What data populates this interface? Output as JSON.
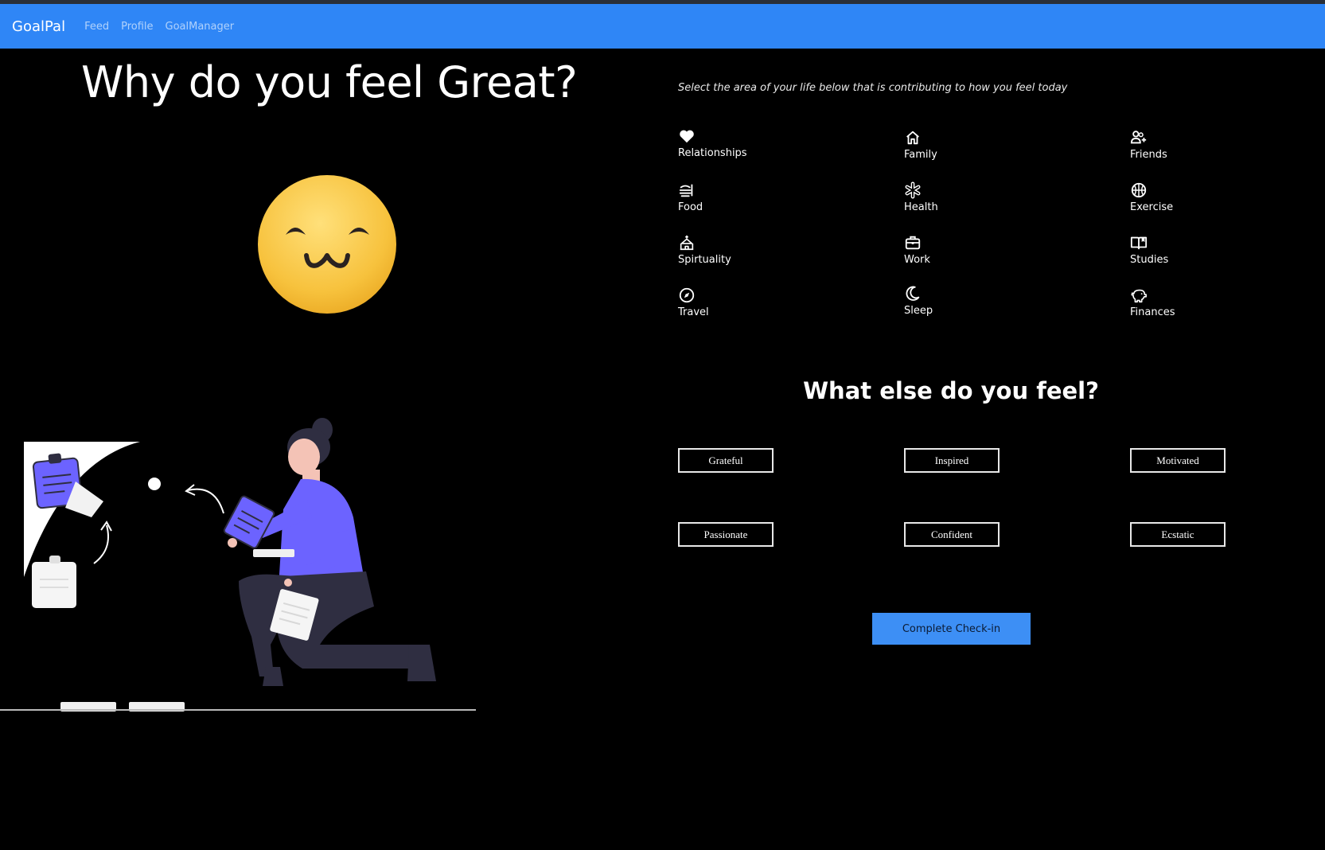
{
  "nav": {
    "brand": "GoalPal",
    "links": [
      "Feed",
      "Profile",
      "GoalManager"
    ]
  },
  "main": {
    "heading": "Why do you feel Great?",
    "instruction": "Select the area of your life below that is contributing to how you feel today",
    "areas": [
      {
        "label": "Relationships",
        "icon": "heart-icon"
      },
      {
        "label": "Family",
        "icon": "home-icon"
      },
      {
        "label": "Friends",
        "icon": "people-add-icon"
      },
      {
        "label": "Food",
        "icon": "food-icon"
      },
      {
        "label": "Health",
        "icon": "health-icon"
      },
      {
        "label": "Exercise",
        "icon": "basketball-icon"
      },
      {
        "label": "Spirtuality",
        "icon": "temple-icon"
      },
      {
        "label": "Work",
        "icon": "briefcase-icon"
      },
      {
        "label": "Studies",
        "icon": "book-icon"
      },
      {
        "label": "Travel",
        "icon": "compass-icon"
      },
      {
        "label": "Sleep",
        "icon": "moon-icon"
      },
      {
        "label": "Finances",
        "icon": "piggy-bank-icon"
      }
    ],
    "subheading": "What else do you feel?",
    "feelings": [
      "Grateful",
      "Inspired",
      "Motivated",
      "Passionate",
      "Confident",
      "Ecstatic"
    ],
    "complete_label": "Complete Check-in"
  },
  "colors": {
    "navbar": "#2f86f6",
    "background": "#000000",
    "button": "#3d8ff5",
    "emoji": "#f9c63f",
    "accent_purple": "#6c63ff"
  }
}
